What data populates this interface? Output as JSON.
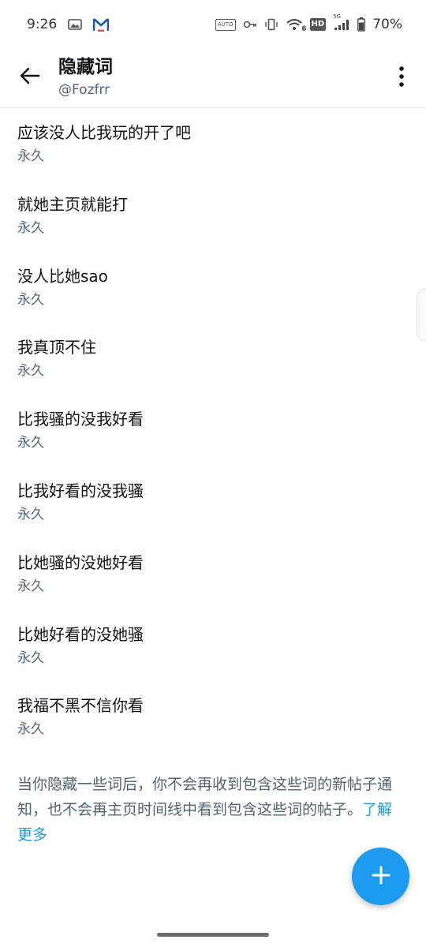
{
  "status_bar": {
    "time": "9:26",
    "battery": "70%",
    "network_badge": "5G",
    "hd_badge": "HD",
    "auto_badge": "AUTO",
    "wifi_badge": "6"
  },
  "header": {
    "title": "隐藏词",
    "handle": "@Fozfrr"
  },
  "muted_words": [
    {
      "word": "应该没人比我玩的开了吧",
      "duration": "永久"
    },
    {
      "word": "就她主页就能打",
      "duration": "永久"
    },
    {
      "word": "没人比她sao",
      "duration": "永久"
    },
    {
      "word": "我真顶不住",
      "duration": "永久"
    },
    {
      "word": "比我骚的没我好看",
      "duration": "永久"
    },
    {
      "word": "比我好看的没我骚",
      "duration": "永久"
    },
    {
      "word": "比她骚的没她好看",
      "duration": "永久"
    },
    {
      "word": "比她好看的没她骚",
      "duration": "永久"
    },
    {
      "word": "我福不黑不信你看",
      "duration": "永久"
    }
  ],
  "footer": {
    "note": "当你隐藏一些词后，你不会再收到包含这些词的新帖子通知，也不会再主页时间线中看到包含这些词的帖子。",
    "link_label": "了解 更多"
  },
  "colors": {
    "accent": "#1d9bf0",
    "secondary_text": "#536471",
    "primary_text": "#0f1419"
  },
  "icons": {
    "back": "arrow-left-icon",
    "more": "more-vertical-icon",
    "fab": "plus-icon"
  }
}
